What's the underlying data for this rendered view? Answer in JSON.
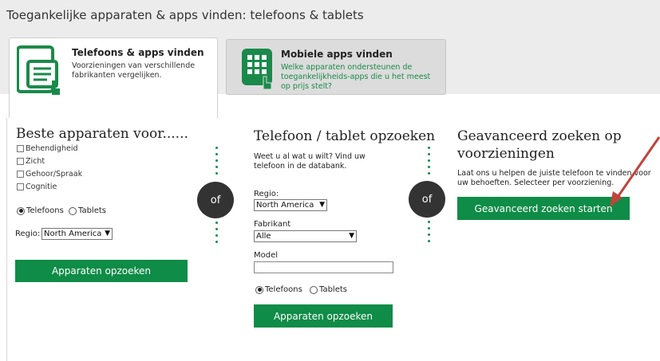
{
  "page_title": "Toegankelijke apparaten & apps vinden: telefoons & tablets",
  "tabs": [
    {
      "title": "Telefoons & apps vinden",
      "desc": "Voorzieningen van verschillende fabrikanten vergelijken.",
      "icon": "phone-tablet-icon"
    },
    {
      "title": "Mobiele apps vinden",
      "desc": "Welke apparaten ondersteunen de toegankelijkheids-apps die u het meest op prijs stelt?",
      "icon": "apps-grid-icon"
    }
  ],
  "left": {
    "title": "Beste apparaten voor......",
    "checkboxes": [
      "Behendigheid",
      "Zicht",
      "Gehoor/Spraak",
      "Cognitie"
    ],
    "radio_options": [
      "Telefoons",
      "Tablets"
    ],
    "radio_selected": "Telefoons",
    "region_label": "Regio:",
    "region_value": "North America",
    "button": "Apparaten opzoeken"
  },
  "or_label": "of",
  "middle": {
    "title": "Telefoon / tablet opzoeken",
    "intro": "Weet u al wat u wilt? Vind uw telefoon in de databank.",
    "region_label": "Regio:",
    "region_value": "North America",
    "manufacturer_label": "Fabrikant",
    "manufacturer_value": "Alle",
    "model_label": "Model",
    "model_value": "",
    "radio_options": [
      "Telefoons",
      "Tablets"
    ],
    "radio_selected": "Telefoons",
    "button": "Apparaten opzoeken"
  },
  "right": {
    "title": "Geavanceerd zoeken op voorzieningen",
    "intro": "Laat ons u helpen de juiste telefoon te vinden voor uw behoeften. Selecteer per voorziening.",
    "button": "Geavanceerd zoeken starten"
  },
  "colors": {
    "brand_green": "#0f8c47",
    "annotation_arrow": "#c0443c"
  }
}
